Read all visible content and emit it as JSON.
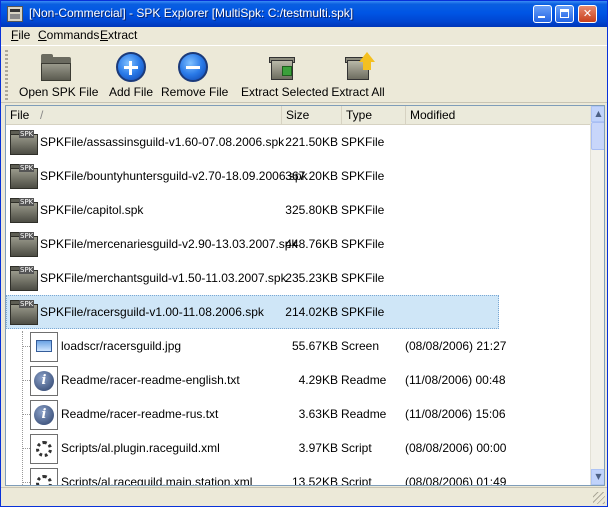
{
  "window": {
    "title": "[Non-Commercial] - SPK Explorer [MultiSpk: C:/testmulti.spk]"
  },
  "menu": [
    "File",
    "Commands",
    "Extract"
  ],
  "toolbar": {
    "open": "Open SPK File",
    "add": "Add File",
    "remove": "Remove File",
    "extract_selected": "Extract Selected",
    "extract_all": "Extract All"
  },
  "columns": {
    "file": "File",
    "sort_indicator": "/",
    "size": "Size",
    "type": "Type",
    "modified": "Modified"
  },
  "rows": [
    {
      "name": "SPKFile/assassinsguild-v1.60-07.08.2006.spk",
      "size": "221.50KB",
      "type": "SPKFile",
      "modified": ""
    },
    {
      "name": "SPKFile/bountyhuntersguild-v2.70-18.09.2006.spk",
      "size": "367.20KB",
      "type": "SPKFile",
      "modified": ""
    },
    {
      "name": "SPKFile/capitol.spk",
      "size": "325.80KB",
      "type": "SPKFile",
      "modified": ""
    },
    {
      "name": "SPKFile/mercenariesguild-v2.90-13.03.2007.spk",
      "size": "448.76KB",
      "type": "SPKFile",
      "modified": ""
    },
    {
      "name": "SPKFile/merchantsguild-v1.50-11.03.2007.spk",
      "size": "235.23KB",
      "type": "SPKFile",
      "modified": ""
    },
    {
      "name": "SPKFile/racersguild-v1.00-11.08.2006.spk",
      "size": "214.02KB",
      "type": "SPKFile",
      "modified": ""
    },
    {
      "name": "loadscr/racersguild.jpg",
      "size": "55.67KB",
      "type": "Screen",
      "modified": "(08/08/2006) 21:27"
    },
    {
      "name": "Readme/racer-readme-english.txt",
      "size": "4.29KB",
      "type": "Readme",
      "modified": "(11/08/2006) 00:48"
    },
    {
      "name": "Readme/racer-readme-rus.txt",
      "size": "3.63KB",
      "type": "Readme",
      "modified": "(11/08/2006) 15:06"
    },
    {
      "name": "Scripts/al.plugin.raceguild.xml",
      "size": "3.97KB",
      "type": "Script",
      "modified": "(08/08/2006) 00:00"
    },
    {
      "name": "Scripts/al.raceguild.main.station.xml",
      "size": "13.52KB",
      "type": "Script",
      "modified": "(08/08/2006) 01:49"
    }
  ]
}
